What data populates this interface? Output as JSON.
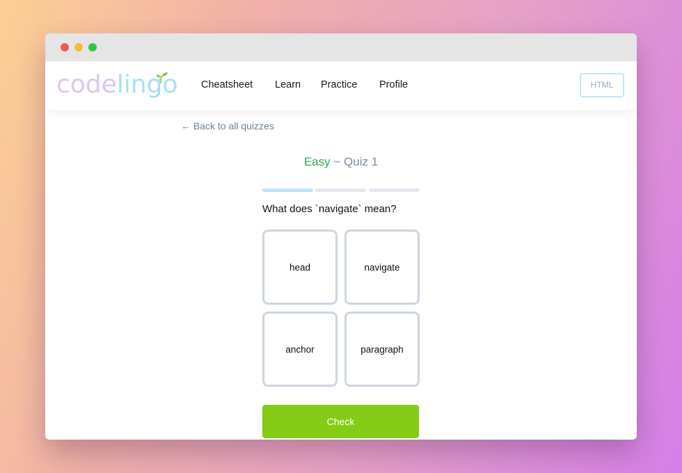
{
  "window": {
    "traffic_lights": [
      "#ee5a52",
      "#f5bd2f",
      "#2ec745"
    ]
  },
  "brand": {
    "logo_part_1": "code",
    "logo_part_2": "lingo",
    "logo_color_1": "#dcc6f2",
    "logo_color_2": "#a6dff4",
    "sprout_color": "#8bc34a"
  },
  "nav": {
    "links": [
      "Cheatsheet",
      "Learn",
      "Practice",
      "Profile"
    ],
    "language_button": "HTML"
  },
  "quiz": {
    "back_link": "← Back to all quizzes",
    "difficulty": "Easy",
    "title_rest": " ~ Quiz 1",
    "progress": {
      "total": 3,
      "current": 1,
      "active_color": "#bfe3f7",
      "inactive_color": "#e3e8ef"
    },
    "question": "What does `navigate` mean?",
    "options": [
      "head",
      "navigate",
      "anchor",
      "paragraph"
    ],
    "check_label": "Check",
    "check_color": "#84cc16"
  }
}
